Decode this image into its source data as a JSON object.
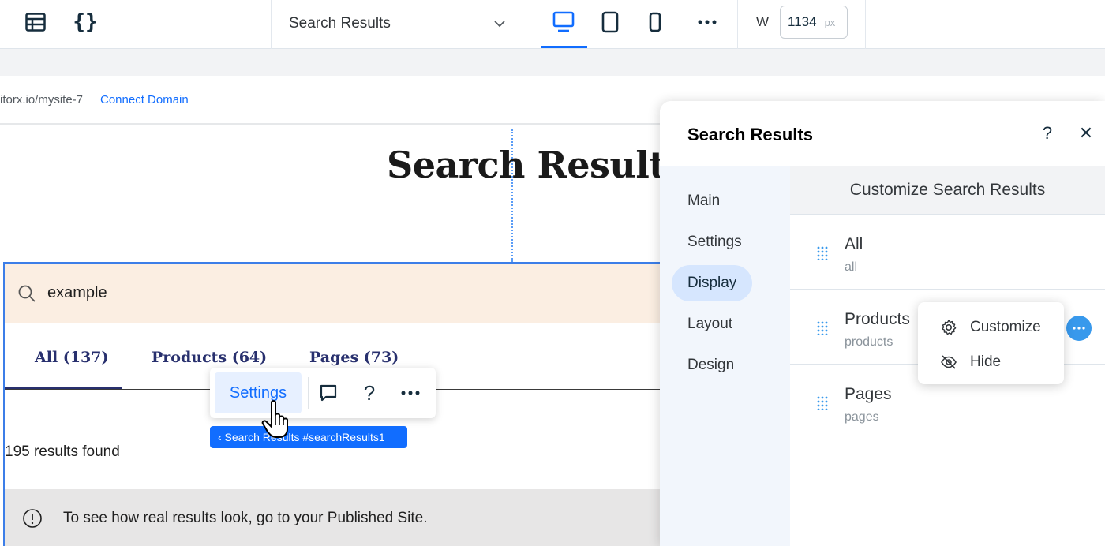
{
  "toolbar": {
    "page_select": "Search Results",
    "width_label": "W",
    "width_value": "1134",
    "width_unit": "px"
  },
  "site": {
    "url": "itorx.io/mysite-7",
    "connect_domain": "Connect Domain",
    "page_title": "Search Results",
    "search_value": "example",
    "tabs": [
      {
        "label": "All (137)"
      },
      {
        "label": "Products (64)"
      },
      {
        "label": "Pages (73)"
      }
    ],
    "results_found": "195 results found",
    "notice": "To see how real results look, go to your Published Site."
  },
  "action_bar": {
    "settings_label": "Settings",
    "help_label": "?",
    "component_tag": "‹ Search Results #searchResults1"
  },
  "panel": {
    "title": "Search Results",
    "help": "?",
    "close": "✕",
    "nav": [
      {
        "label": "Main"
      },
      {
        "label": "Settings"
      },
      {
        "label": "Display"
      },
      {
        "label": "Layout"
      },
      {
        "label": "Design"
      }
    ],
    "active_nav": "Display",
    "content_title": "Customize Search Results",
    "rows": [
      {
        "name": "All",
        "sub": "all"
      },
      {
        "name": "Products",
        "sub": "products"
      },
      {
        "name": "Pages",
        "sub": "pages"
      }
    ],
    "context_menu": [
      {
        "label": "Customize",
        "icon": "gear-icon"
      },
      {
        "label": "Hide",
        "icon": "eye-off-icon"
      }
    ]
  },
  "colors": {
    "accent": "#116dff",
    "tab_text": "#28306e",
    "search_bg": "#fbeee2",
    "nav_active": "#d6e6fe"
  }
}
